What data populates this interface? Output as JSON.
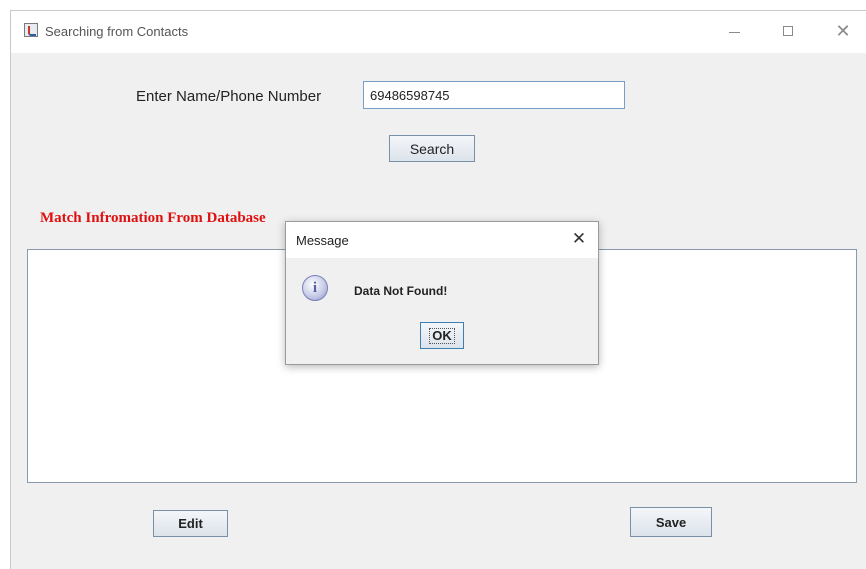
{
  "window": {
    "title": "Searching from Contacts"
  },
  "search": {
    "label": "Enter Name/Phone Number",
    "value": "69486598745",
    "button_label": "Search"
  },
  "results": {
    "heading": "Match Infromation From Database"
  },
  "actions": {
    "edit_label": "Edit",
    "save_label": "Save"
  },
  "dialog": {
    "title": "Message",
    "message": "Data Not Found!",
    "ok_label": "OK"
  },
  "icons": {
    "app": "java-app-icon",
    "minimize": "minimize-icon",
    "maximize": "maximize-icon",
    "close": "close-icon",
    "info": "info-icon"
  }
}
